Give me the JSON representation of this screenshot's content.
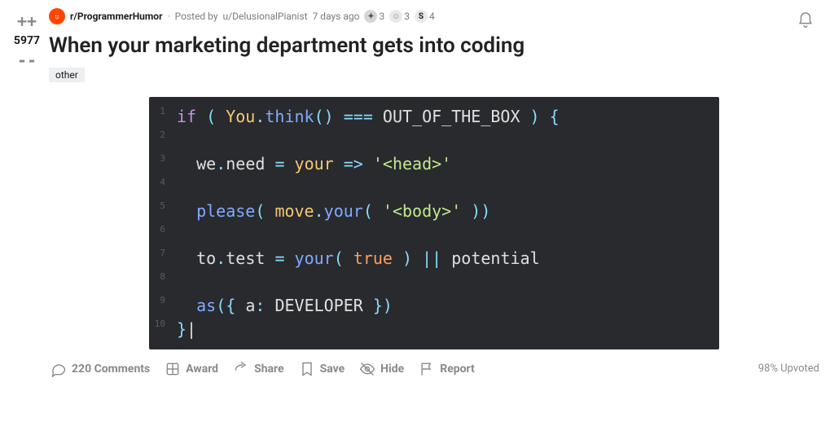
{
  "header": {
    "subreddit": "r/ProgrammerHumor",
    "posted_by_prefix": "Posted by",
    "author": "u/DelusionalPianist",
    "age": "7 days ago",
    "awards": [
      {
        "name": "silver",
        "count": "3"
      },
      {
        "name": "wholesome",
        "count": "3"
      },
      {
        "name": "s-award",
        "count": "4"
      }
    ]
  },
  "vote": {
    "score": "5977"
  },
  "post": {
    "title": "When your marketing department gets into coding",
    "flair": "other"
  },
  "code": {
    "lines": [
      {
        "n": "1",
        "tokens": [
          [
            "kw",
            "if "
          ],
          [
            "punc",
            "( "
          ],
          [
            "cls",
            "You"
          ],
          [
            "punc",
            "."
          ],
          [
            "fn",
            "think"
          ],
          [
            "punc",
            "() "
          ],
          [
            "op",
            "=== "
          ],
          [
            "const",
            "OUT_OF_THE_BOX "
          ],
          [
            "punc",
            ") {"
          ]
        ]
      },
      {
        "n": "2",
        "tokens": []
      },
      {
        "n": "3",
        "tokens": [
          [
            "white",
            "  "
          ],
          [
            "prop",
            "we"
          ],
          [
            "punc",
            "."
          ],
          [
            "prop",
            "need "
          ],
          [
            "op",
            "= "
          ],
          [
            "cls",
            "your "
          ],
          [
            "op",
            "=> "
          ],
          [
            "str",
            "'<head>'"
          ]
        ]
      },
      {
        "n": "4",
        "tokens": []
      },
      {
        "n": "5",
        "tokens": [
          [
            "white",
            "  "
          ],
          [
            "fn",
            "please"
          ],
          [
            "punc",
            "( "
          ],
          [
            "cls",
            "move"
          ],
          [
            "punc",
            "."
          ],
          [
            "fn",
            "your"
          ],
          [
            "punc",
            "( "
          ],
          [
            "str",
            "'<body>'"
          ],
          [
            "punc",
            " ))"
          ]
        ]
      },
      {
        "n": "6",
        "tokens": []
      },
      {
        "n": "7",
        "tokens": [
          [
            "white",
            "  "
          ],
          [
            "prop",
            "to"
          ],
          [
            "punc",
            "."
          ],
          [
            "prop",
            "test "
          ],
          [
            "op",
            "= "
          ],
          [
            "fn",
            "your"
          ],
          [
            "punc",
            "( "
          ],
          [
            "bool",
            "true"
          ],
          [
            "punc",
            " ) "
          ],
          [
            "op",
            "|| "
          ],
          [
            "prop",
            "potential"
          ]
        ]
      },
      {
        "n": "8",
        "tokens": []
      },
      {
        "n": "9",
        "tokens": [
          [
            "white",
            "  "
          ],
          [
            "fn",
            "as"
          ],
          [
            "punc",
            "({ "
          ],
          [
            "prop",
            "a"
          ],
          [
            "punc",
            ": "
          ],
          [
            "dev",
            "DEVELOPER "
          ],
          [
            "punc",
            "})"
          ]
        ]
      },
      {
        "n": "10",
        "tokens": [
          [
            "punc",
            "}"
          ],
          [
            "cursor",
            "|"
          ]
        ]
      }
    ]
  },
  "toolbar": {
    "comments": "220 Comments",
    "award": "Award",
    "share": "Share",
    "save": "Save",
    "hide": "Hide",
    "report": "Report",
    "upvoted": "98% Upvoted"
  }
}
